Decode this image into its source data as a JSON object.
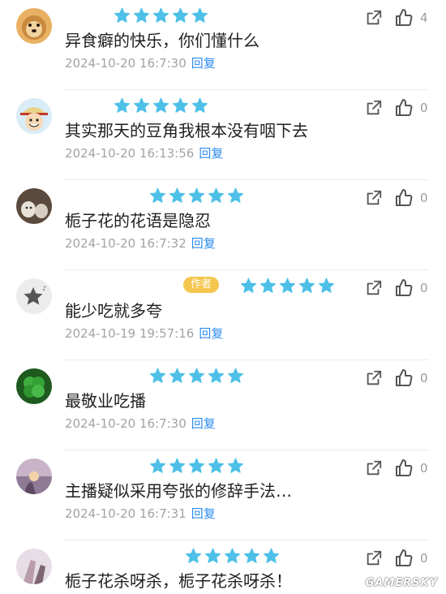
{
  "comments": [
    {
      "text": "异食癖的快乐，你们懂什么",
      "time": "2024-10-20 16:7:30",
      "reply": "回复",
      "likes": "4",
      "stars": 5,
      "avatar": "dog-avatar"
    },
    {
      "text": "其实那天的豆角我根本没有咽下去",
      "time": "2024-10-20 16:13:56",
      "reply": "回复",
      "likes": "0",
      "stars": 5,
      "avatar": "cartoon-avatar"
    },
    {
      "text": "栀子花的花语是隐忍",
      "time": "2024-10-20 16:7:32",
      "reply": "回复",
      "likes": "0",
      "stars": 5,
      "avatar": "cat-avatar"
    },
    {
      "text": "能少吃就多夸",
      "time": "2024-10-19 19:57:16",
      "reply": "回复",
      "likes": "0",
      "stars": 5,
      "avatar": "default-star-avatar",
      "badge": "作者"
    },
    {
      "text": "最敬业吃播",
      "time": "2024-10-20 16:7:30",
      "reply": "回复",
      "likes": "0",
      "stars": 5,
      "avatar": "clover-avatar"
    },
    {
      "text": "主播疑似采用夸张的修辞手法…",
      "time": "2024-10-20 16:7:31",
      "reply": "回复",
      "likes": "0",
      "stars": 5,
      "avatar": "sunset-avatar"
    },
    {
      "text": "栀子花杀呀杀，栀子花杀呀杀！",
      "time": "",
      "reply": "",
      "likes": "0",
      "stars": 5,
      "avatar": "photo-avatar"
    }
  ],
  "watermark": "GAMERSKY",
  "colors": {
    "star": "#4ec0e8",
    "reply": "#2d8cf0",
    "badge": "#f5c64f",
    "meta": "#a3a3a3",
    "icon": "#555555"
  }
}
